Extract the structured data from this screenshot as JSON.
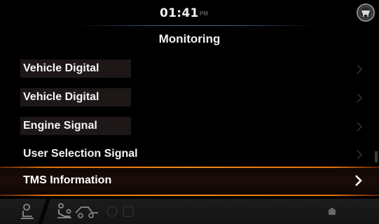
{
  "status_bar": {
    "time": "01:41",
    "ampm": "PM"
  },
  "header": {
    "title": "Monitoring"
  },
  "menu": {
    "items": [
      {
        "label": "Vehicle Digital"
      },
      {
        "label": "Vehicle Digital"
      },
      {
        "label": "Engine Signal"
      },
      {
        "label": "User Selection Signal"
      },
      {
        "label": "TMS Information",
        "selected": true
      }
    ]
  },
  "icons": {
    "corner": "vehicle-badge-icon",
    "bottom": [
      "operator-seat-icon",
      "driving-mode-icon",
      "work-mode-icon",
      "settings-icon"
    ]
  },
  "colors": {
    "selection_accent": "#f08a18",
    "background": "#000000",
    "label_bg": "#1d1817"
  }
}
